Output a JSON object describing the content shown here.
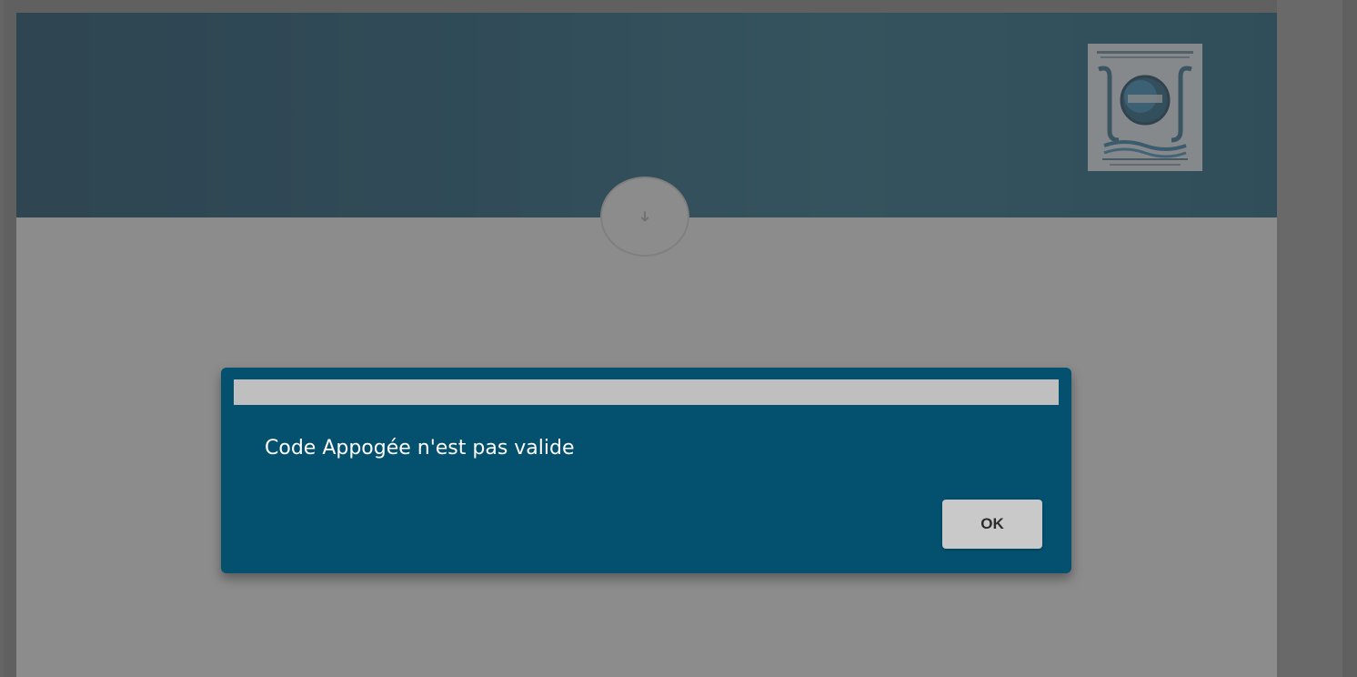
{
  "page": {
    "background_color": "#ffffff",
    "banner_color": "#0f5576"
  },
  "header": {
    "logo_icon": "university-logo-icon",
    "scroll_icon": "arrow-down-icon",
    "scroll_glyph": "➜"
  },
  "dialog": {
    "message": "Code Appogée n'est pas valide",
    "ok_label": "OK",
    "background_color": "#03506f",
    "titlebar_color": "#bfbfbf"
  }
}
